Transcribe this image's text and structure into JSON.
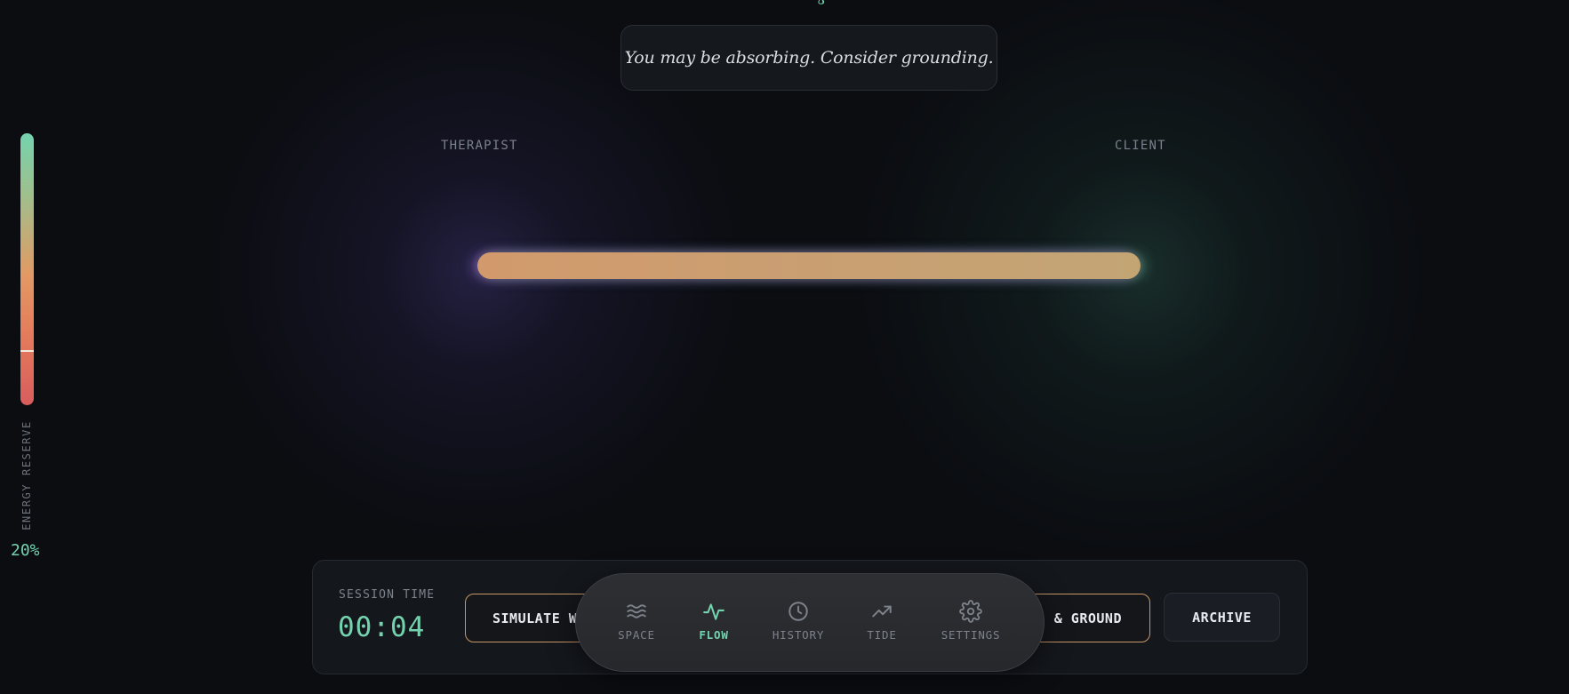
{
  "notice": {
    "text": "You may be absorbing. Consider grounding."
  },
  "participants": {
    "left": "THERAPIST",
    "right": "CLIENT"
  },
  "energy": {
    "label": "ENERGY RESERVE",
    "percent_text": "20%",
    "level": 0.2
  },
  "session": {
    "label": "SESSION TIME",
    "time": "00:04"
  },
  "actions": {
    "simulate_label": "SIMULATE W",
    "release_label": "& GROUND",
    "archive_label": "ARCHIVE"
  },
  "nav": {
    "items": [
      {
        "label": "SPACE",
        "icon": "waves-icon",
        "active": false
      },
      {
        "label": "FLOW",
        "icon": "pulse-icon",
        "active": true
      },
      {
        "label": "HISTORY",
        "icon": "clock-icon",
        "active": false
      },
      {
        "label": "TIDE",
        "icon": "trend-up-icon",
        "active": false
      },
      {
        "label": "SETTINGS",
        "icon": "gear-icon",
        "active": false
      }
    ]
  },
  "colors": {
    "accent": "#74d3ae",
    "amber": "#c99867",
    "flow_bar": "#cfa070",
    "background": "#0b0d11"
  }
}
